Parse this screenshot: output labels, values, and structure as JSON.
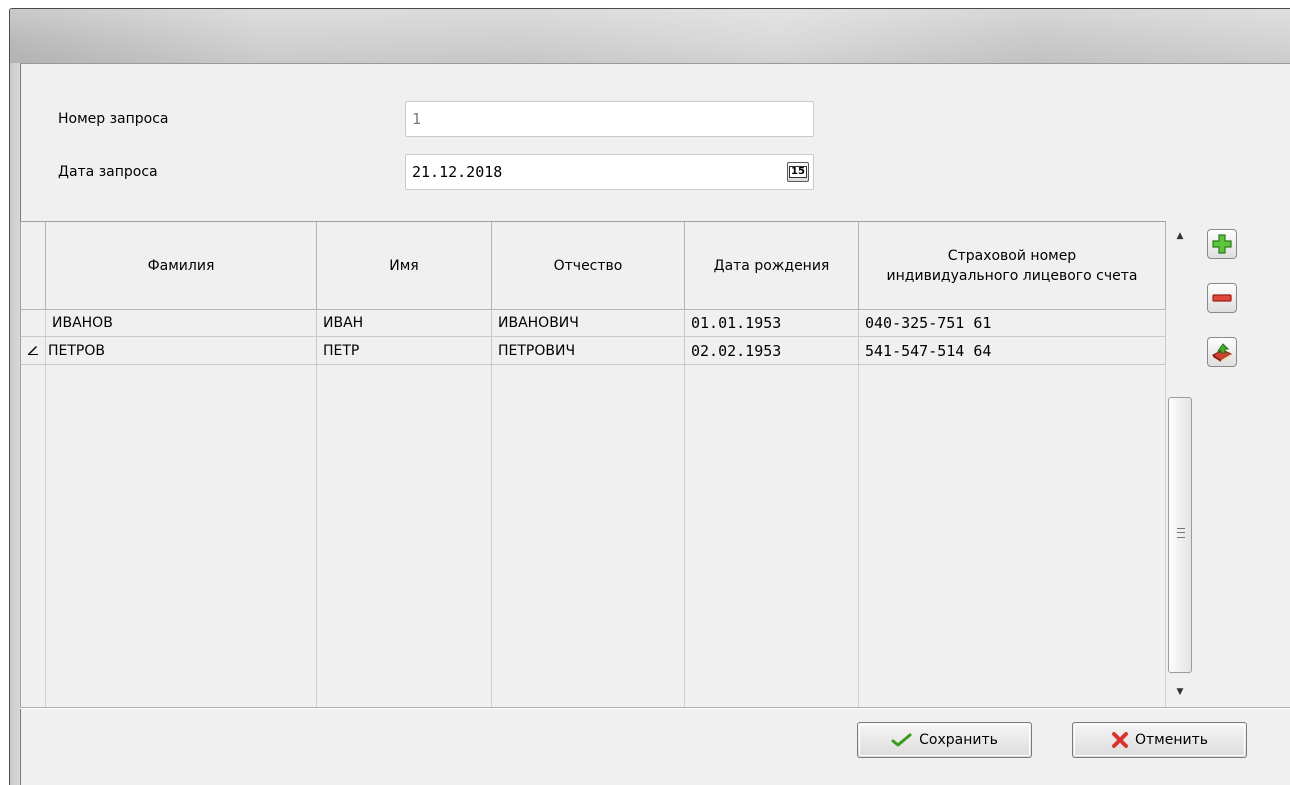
{
  "form": {
    "request_number_label": "Номер запроса",
    "request_number_value": "1",
    "request_date_label": "Дата запроса",
    "request_date_value": "21.12.2018",
    "calendar_button_text": "15"
  },
  "table": {
    "columns": [
      "Фамилия",
      "Имя",
      "Отчество",
      "Дата рождения",
      "Страховой номер индивидуального лицевого счета"
    ],
    "rows": [
      {
        "last_name": "ИВАНОВ",
        "first_name": "ИВАН",
        "patronymic": "ИВАНОВИЧ",
        "birth_date": "01.01.1953",
        "snils": "040-325-751 61",
        "editing": false
      },
      {
        "last_name": "ПЕТРОВ",
        "first_name": "ПЕТР",
        "patronymic": "ПЕТРОВИЧ",
        "birth_date": "02.02.1953",
        "snils": "541-547-514 64",
        "editing": true
      }
    ]
  },
  "side_buttons": {
    "add_icon": "plus-icon",
    "remove_icon": "minus-icon",
    "import_icon": "import-book-icon"
  },
  "footer": {
    "save_label": "Сохранить",
    "cancel_label": "Отменить"
  },
  "colors": {
    "background": "#f0f0f0",
    "add_green": "#3fa52f",
    "remove_red": "#d8342b",
    "cancel_red": "#d8342b",
    "save_check_green": "#3a9a1c"
  }
}
